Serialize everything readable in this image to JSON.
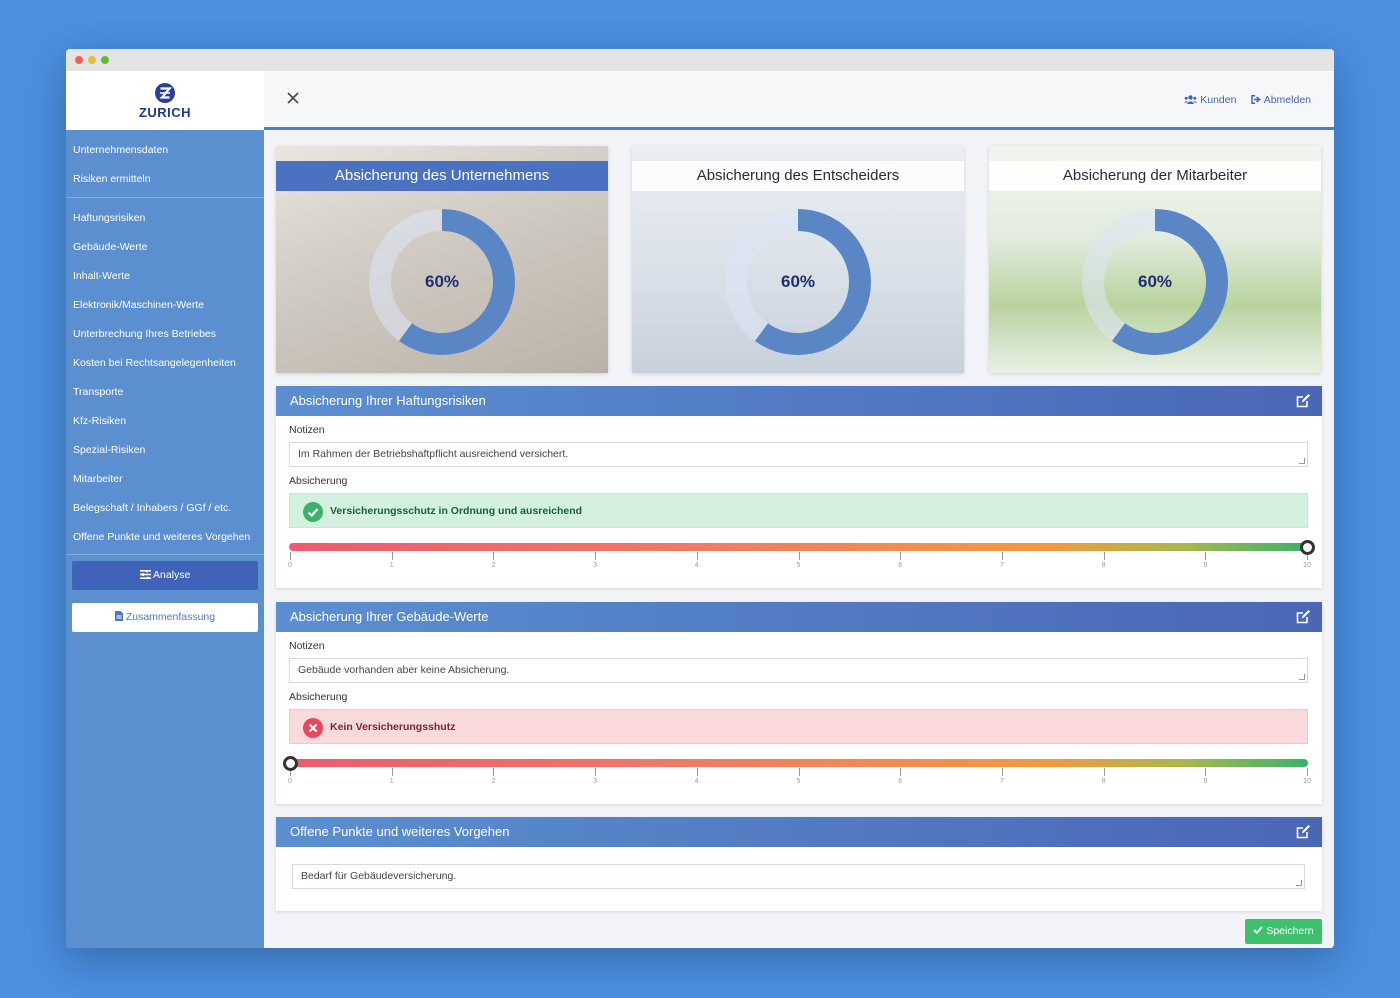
{
  "logo": {
    "text": "ZURICH"
  },
  "sidebar": {
    "group1": [
      {
        "label": "Unternehmensdaten"
      },
      {
        "label": "Risiken ermitteln"
      }
    ],
    "group2": [
      {
        "label": "Haftungsrisiken"
      },
      {
        "label": "Gebäude-Werte"
      },
      {
        "label": "Inhalt-Werte"
      },
      {
        "label": "Elektronik/Maschinen-Werte"
      },
      {
        "label": "Unterbrechung Ihres Betriebes"
      },
      {
        "label": "Kosten bei Rechtsangelegenheiten"
      },
      {
        "label": "Transporte"
      },
      {
        "label": "Kfz-Risiken"
      },
      {
        "label": "Spezial-Risiken"
      },
      {
        "label": "Mitarbeiter"
      },
      {
        "label": "Belegschaft / Inhabers / GGf / etc."
      },
      {
        "label": "Offene Punkte und weiteres Vorgehen"
      }
    ],
    "analyse_label": "Analyse",
    "zusammenfassung_label": "Zusammenfassung"
  },
  "header": {
    "kunden_label": "Kunden",
    "abmelden_label": "Abmelden"
  },
  "cards": [
    {
      "title": "Absicherung des Unternehmens",
      "percent_label": "60%",
      "value": 0.6,
      "active": true
    },
    {
      "title": "Absicherung des Entscheiders",
      "percent_label": "60%",
      "value": 0.6,
      "active": false
    },
    {
      "title": "Absicherung der Mitarbeiter",
      "percent_label": "60%",
      "value": 0.6,
      "active": false
    }
  ],
  "sections": {
    "haftung": {
      "title": "Absicherung Ihrer Haftungsrisiken",
      "notes_label": "Notizen",
      "notes_value": "Im Rahmen der Betriebshaftpflicht ausreichend versichert.",
      "coverage_label": "Absicherung",
      "status_text": "Versicherungsschutz in Ordnung und ausreichend",
      "slider_value": 10
    },
    "gebaeude": {
      "title": "Absicherung Ihrer Gebäude-Werte",
      "notes_label": "Notizen",
      "notes_value": "Gebäude vorhanden aber keine Absicherung.",
      "coverage_label": "Absicherung",
      "status_text": "Kein Versicherungsshutz",
      "slider_value": 0
    },
    "offen": {
      "title": "Offene Punkte und weiteres Vorgehen",
      "notes_value": "Bedarf für Gebäudeversicherung."
    }
  },
  "slider_ticks": [
    "0",
    "1",
    "2",
    "3",
    "4",
    "5",
    "6",
    "7",
    "8",
    "9",
    "10"
  ],
  "save_label": "Speichern",
  "colors": {
    "accent": "#4b72c1",
    "sidebar": "#5b8fd0",
    "success": "#3ec06c",
    "danger": "#e8475f",
    "donut": "#5b86c6"
  }
}
